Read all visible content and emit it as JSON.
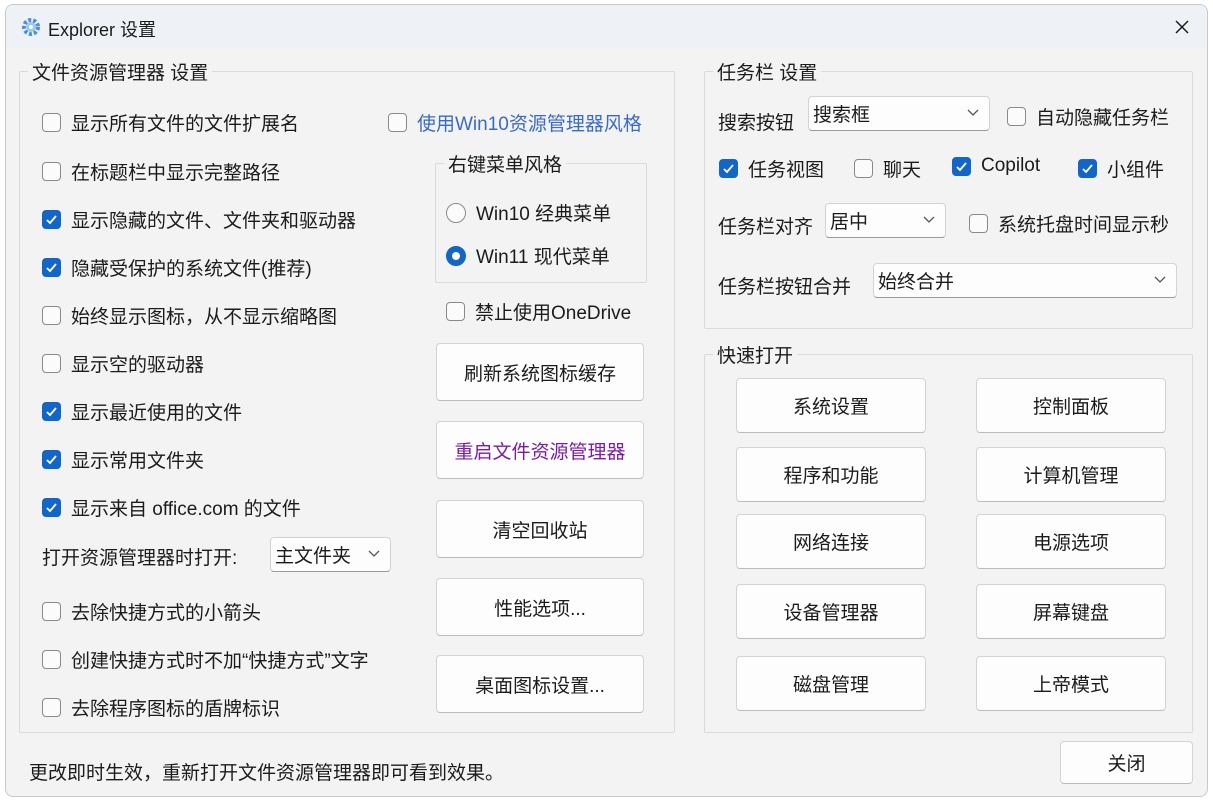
{
  "window": {
    "title": "Explorer 设置",
    "icon": "gear-icon",
    "accent": "#1466c6"
  },
  "explorer": {
    "title": "文件资源管理器 设置",
    "options": [
      {
        "label": "显示所有文件的文件扩展名",
        "checked": false
      },
      {
        "label": "在标题栏中显示完整路径",
        "checked": false
      },
      {
        "label": "显示隐藏的文件、文件夹和驱动器",
        "checked": true
      },
      {
        "label": "隐藏受保护的系统文件(推荐)",
        "checked": true
      },
      {
        "label": "始终显示图标，从不显示缩略图",
        "checked": false
      },
      {
        "label": "显示空的驱动器",
        "checked": false
      },
      {
        "label": "显示最近使用的文件",
        "checked": true
      },
      {
        "label": "显示常用文件夹",
        "checked": true
      },
      {
        "label": "显示来自 office.com 的文件",
        "checked": true
      }
    ],
    "open_label": "打开资源管理器时打开:",
    "open_value": "主文件夹",
    "options2": [
      {
        "label": "去除快捷方式的小箭头",
        "checked": false
      },
      {
        "label": "创建快捷方式时不加“快捷方式”文字",
        "checked": false
      },
      {
        "label": "去除程序图标的盾牌标识",
        "checked": false
      }
    ],
    "win10_style": {
      "label": "使用Win10资源管理器风格",
      "checked": false
    },
    "context_menu": {
      "title": "右键菜单风格",
      "options": [
        {
          "label": "Win10 经典菜单",
          "selected": false
        },
        {
          "label": "Win11 现代菜单",
          "selected": true
        }
      ]
    },
    "onedrive": {
      "label": "禁止使用OneDrive",
      "checked": false
    },
    "buttons": {
      "refresh_icons": "刷新系统图标缓存",
      "restart_explorer": "重启文件资源管理器",
      "empty_bin": "清空回收站",
      "performance": "性能选项...",
      "desktop_icons": "桌面图标设置..."
    }
  },
  "taskbar": {
    "title": "任务栏 设置",
    "search_label": "搜索按钮",
    "search_value": "搜索框",
    "auto_hide": {
      "label": "自动隐藏任务栏",
      "checked": false
    },
    "toggles": [
      {
        "label": "任务视图",
        "checked": true
      },
      {
        "label": "聊天",
        "checked": false
      },
      {
        "label": "Copilot",
        "checked": true
      },
      {
        "label": "小组件",
        "checked": true
      }
    ],
    "align_label": "任务栏对齐",
    "align_value": "居中",
    "tray_seconds": {
      "label": "系统托盘时间显示秒",
      "checked": false
    },
    "combine_label": "任务栏按钮合并",
    "combine_value": "始终合并"
  },
  "quick": {
    "title": "快速打开",
    "buttons": [
      "系统设置",
      "控制面板",
      "程序和功能",
      "计算机管理",
      "网络连接",
      "电源选项",
      "设备管理器",
      "屏幕键盘",
      "磁盘管理",
      "上帝模式"
    ]
  },
  "footer": {
    "status": "更改即时生效，重新打开文件资源管理器即可看到效果。",
    "close": "关闭"
  }
}
